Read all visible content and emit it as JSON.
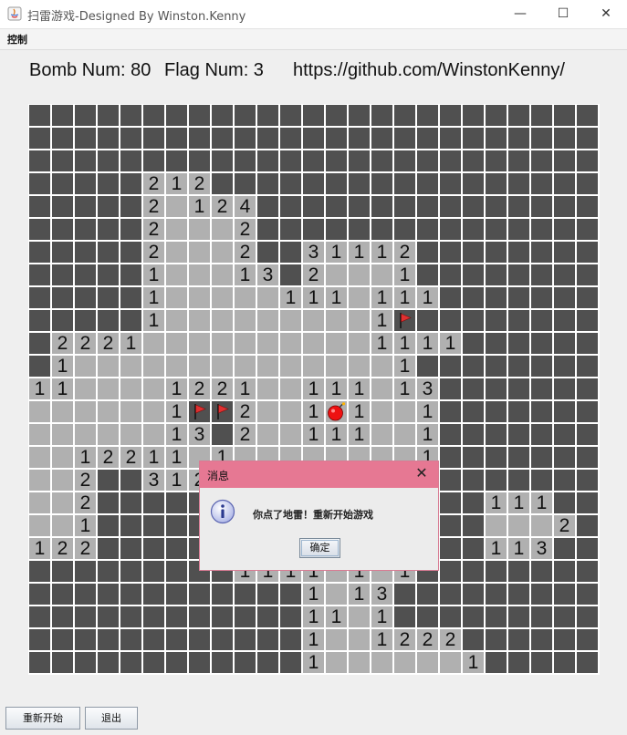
{
  "window": {
    "title": "扫雷游戏-Designed By Winston.Kenny",
    "minimize": "—",
    "maximize": "☐",
    "close": "✕"
  },
  "menu": {
    "items": [
      "控制"
    ]
  },
  "status": {
    "bomb_label": "Bomb Num: 80",
    "flag_label": "Flag Num: 3",
    "url": "https://github.com/WinstonKenny/"
  },
  "board": {
    "rows": 25,
    "cols": 25,
    "legend": "# = covered, . = open empty, 1-8 = open number, F = flag, B = exploded bomb, ? = hidden behind dialog",
    "grid": [
      "#########################",
      "#########################",
      "#########################",
      "#####212#################",
      "#####2.124###############",
      "#####2...2###############",
      "#####2...2##31112########",
      "#####1...13#2...1########",
      "#####1.....111.111#######",
      "#####1.........1F########",
      "#2221..........1111######",
      "#1..............1########",
      "11....1221..111.13#######",
      "......1FF2..1B1..1#######",
      "......13#2..111..1#######",
      "..12211.1........1#######",
      "..2##312??????????#######",
      "..2###??????????????111##",
      "..1###??????????????...2#",
      "122###??????????????113##",
      "#########1111.1.1########",
      "############1.13#########",
      "############11.1#########",
      "############1..1222######",
      "############1......1#####"
    ]
  },
  "dialog": {
    "title": "消息",
    "message": "你点了地雷！重新开始游戏",
    "ok_label": "确定",
    "close": "✕"
  },
  "buttons": {
    "restart": "重新开始",
    "exit": "退出"
  },
  "colors": {
    "covered": "#505050",
    "open": "#b0b0b0",
    "grid": "#ffffff",
    "dialog_title": "#e67893",
    "flag": "#e03030",
    "bomb": "#ee1111"
  }
}
